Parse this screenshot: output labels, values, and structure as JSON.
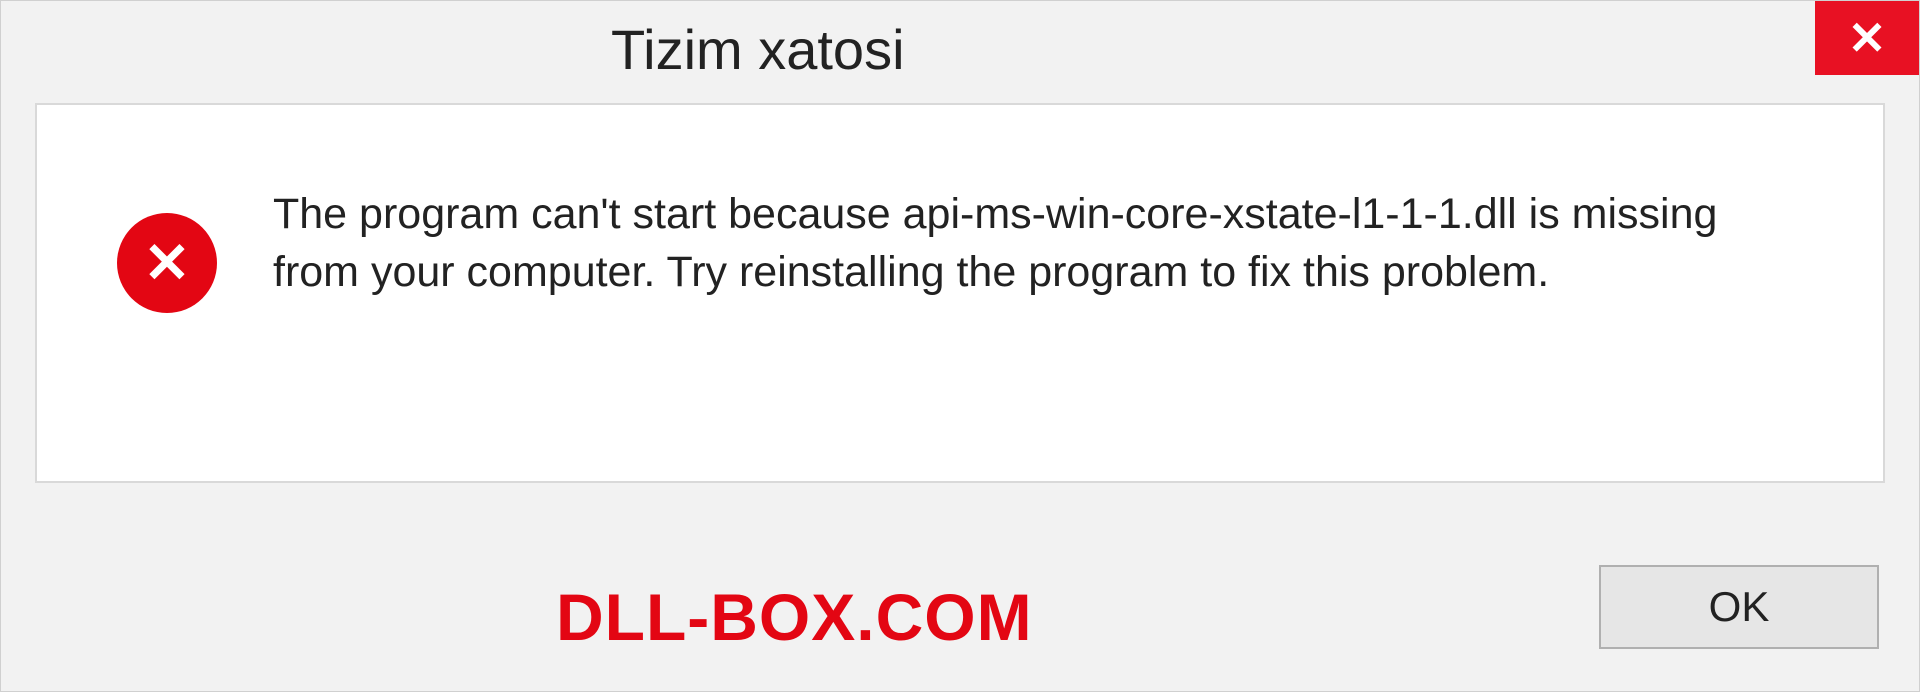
{
  "titlebar": {
    "title": "Tizim xatosi"
  },
  "body": {
    "message": "The program can't start because api-ms-win-core-xstate-l1-1-1.dll is missing from your computer. Try reinstalling the program to fix this problem."
  },
  "footer": {
    "watermark": "DLL-BOX.COM",
    "ok_label": "OK"
  }
}
